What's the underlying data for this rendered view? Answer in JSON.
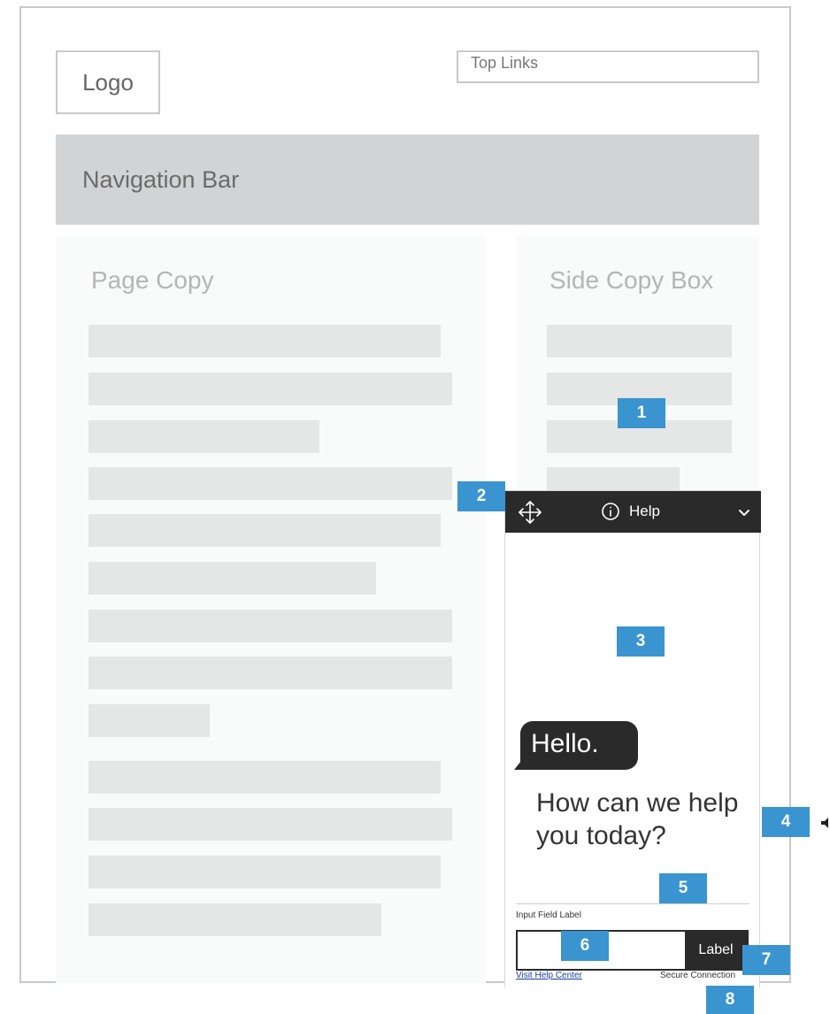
{
  "header": {
    "logo": "Logo",
    "top_links": "Top Links",
    "nav_bar": "Navigation Bar"
  },
  "content": {
    "page_copy_title": "Page Copy",
    "side_copy_title": "Side Copy Box"
  },
  "widget": {
    "title": "Help",
    "greeting": "Hello.",
    "prompt": "How can we help you today?",
    "input_label": "Input Field Label",
    "input_value": "",
    "send_label": "Label",
    "help_link": "Visit Help Center",
    "secure_text": "Secure Connection",
    "header_icons": [
      "move-icon",
      "info-icon",
      "chevron-down-icon"
    ]
  },
  "callouts": [
    "1",
    "2",
    "3",
    "4",
    "5",
    "6",
    "7",
    "8"
  ],
  "colors": {
    "callout": "#3a94cf",
    "widget_dark": "#2a2a2a",
    "nav_bar": "#d2d3d4",
    "placeholder_bar": "#e5e6e6",
    "link": "#1a3c9e"
  }
}
